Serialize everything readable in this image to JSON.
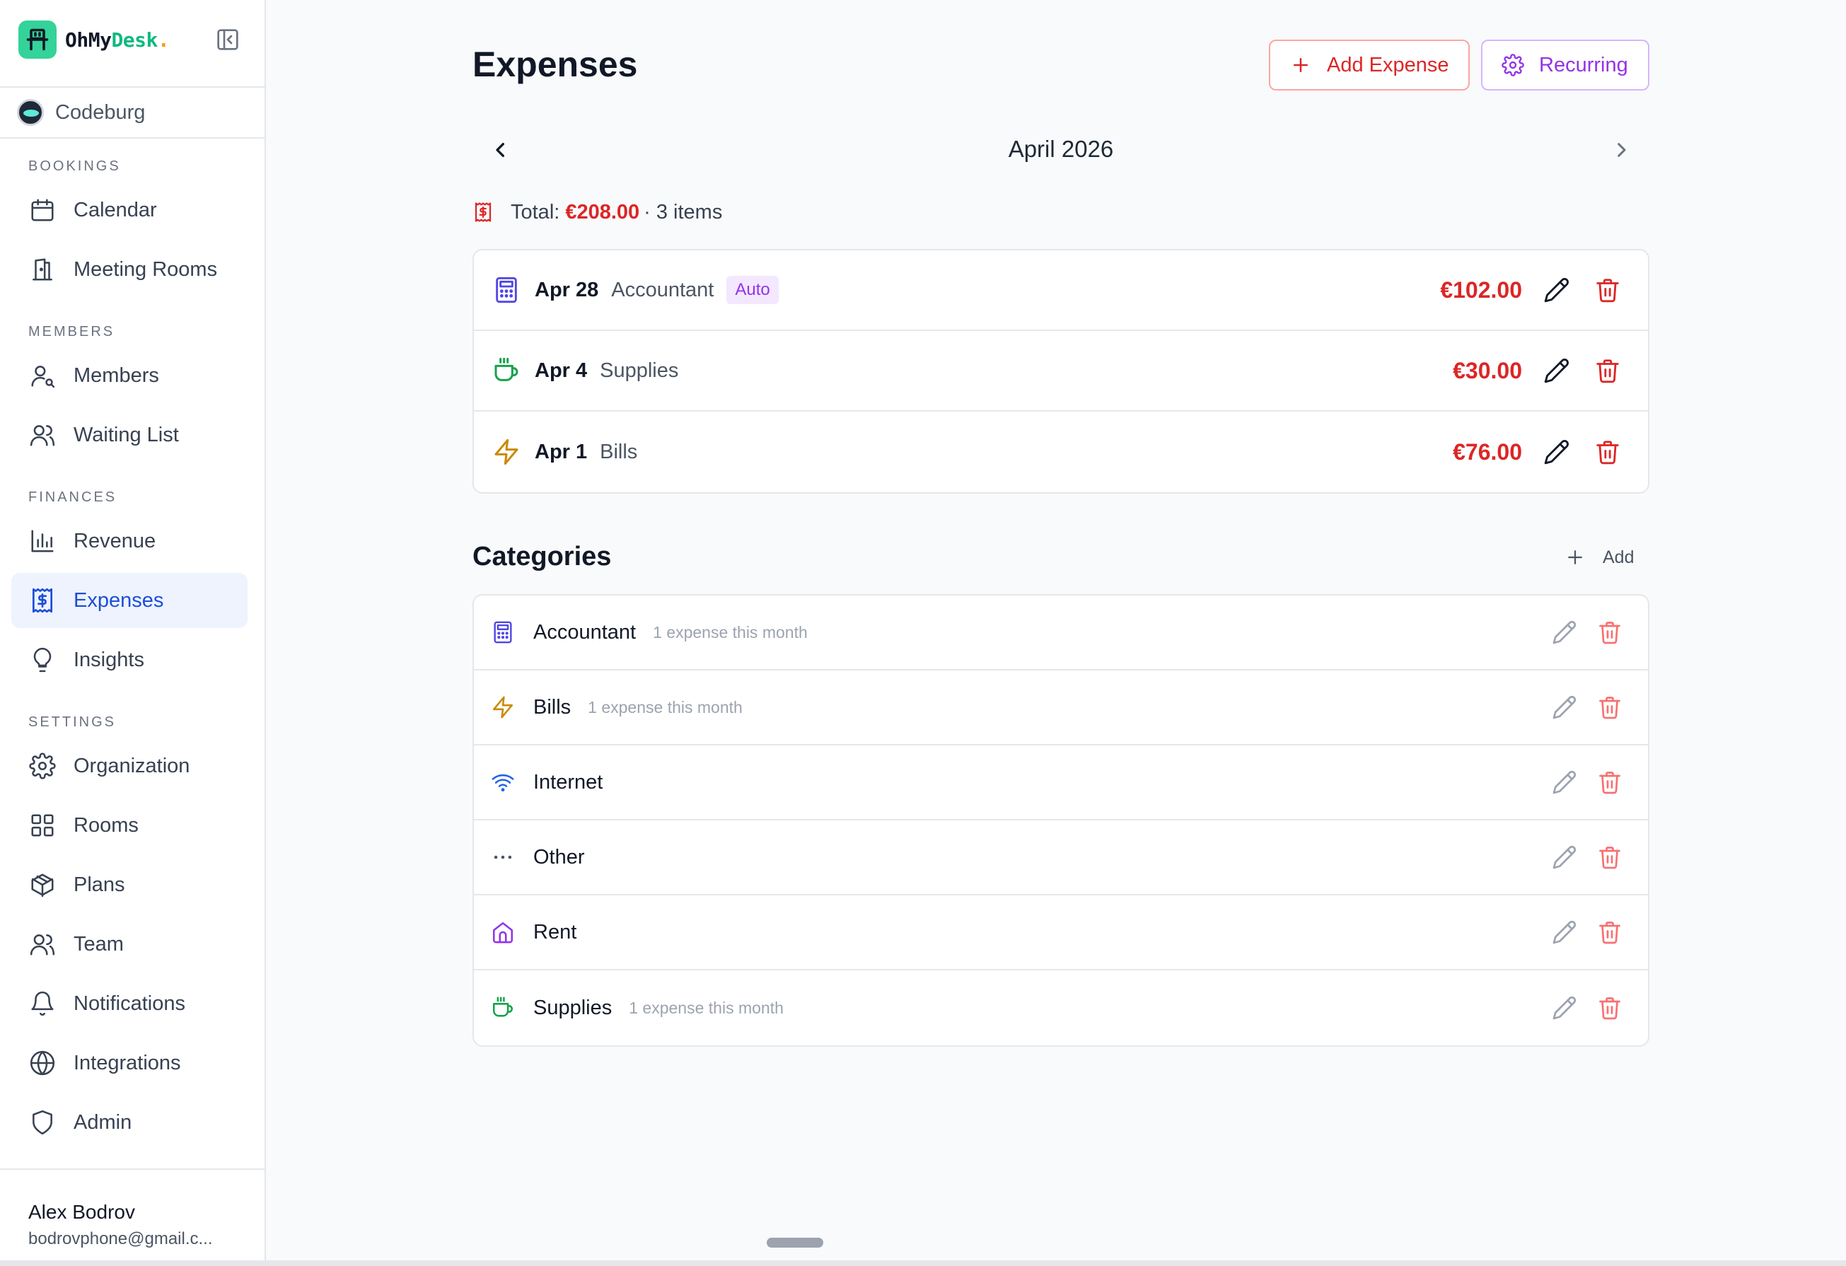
{
  "brand": {
    "name_prefix": "OhMy",
    "name_accent": "Desk",
    "name_dot": "."
  },
  "org": {
    "name": "Codeburg"
  },
  "sidebar": {
    "sections": {
      "bookings": "BOOKINGS",
      "members": "MEMBERS",
      "finances": "FINANCES",
      "settings": "SETTINGS"
    },
    "items": {
      "calendar": "Calendar",
      "meeting_rooms": "Meeting Rooms",
      "members": "Members",
      "waiting_list": "Waiting List",
      "revenue": "Revenue",
      "expenses": "Expenses",
      "insights": "Insights",
      "organization": "Organization",
      "rooms": "Rooms",
      "plans": "Plans",
      "team": "Team",
      "notifications": "Notifications",
      "integrations": "Integrations",
      "admin": "Admin"
    },
    "active": "expenses"
  },
  "user": {
    "name": "Alex Bodrov",
    "email": "bodrovphone@gmail.c..."
  },
  "header": {
    "title": "Expenses",
    "add_expense_label": "Add Expense",
    "recurring_label": "Recurring"
  },
  "month_nav": {
    "month": "April 2026"
  },
  "summary": {
    "total_label": "Total:",
    "total_amount": "€208.00",
    "items_text": "· 3 items"
  },
  "expenses": [
    {
      "date": "Apr 28",
      "category": "Accountant",
      "badge": "Auto",
      "amount": "€102.00",
      "icon": "calculator-icon",
      "color": "#4f46e5"
    },
    {
      "date": "Apr 4",
      "category": "Supplies",
      "badge": "",
      "amount": "€30.00",
      "icon": "coffee-icon",
      "color": "#16a34a"
    },
    {
      "date": "Apr 1",
      "category": "Bills",
      "badge": "",
      "amount": "€76.00",
      "icon": "zap-icon",
      "color": "#ca8a04"
    }
  ],
  "categories": {
    "title": "Categories",
    "add_label": "Add",
    "items": [
      {
        "name": "Accountant",
        "count": "1 expense this month",
        "icon": "calculator-icon",
        "color": "#4f46e5"
      },
      {
        "name": "Bills",
        "count": "1 expense this month",
        "icon": "zap-icon",
        "color": "#ca8a04"
      },
      {
        "name": "Internet",
        "count": "",
        "icon": "wifi-icon",
        "color": "#2563eb"
      },
      {
        "name": "Other",
        "count": "",
        "icon": "more-horizontal-icon",
        "color": "#4b5563"
      },
      {
        "name": "Rent",
        "count": "",
        "icon": "home-icon",
        "color": "#9333ea"
      },
      {
        "name": "Supplies",
        "count": "1 expense this month",
        "icon": "coffee-icon",
        "color": "#16a34a"
      }
    ]
  },
  "colors": {
    "danger": "#dc2626",
    "accent": "#1d4ed8",
    "purple": "#9333ea",
    "brand": "#34d399"
  }
}
